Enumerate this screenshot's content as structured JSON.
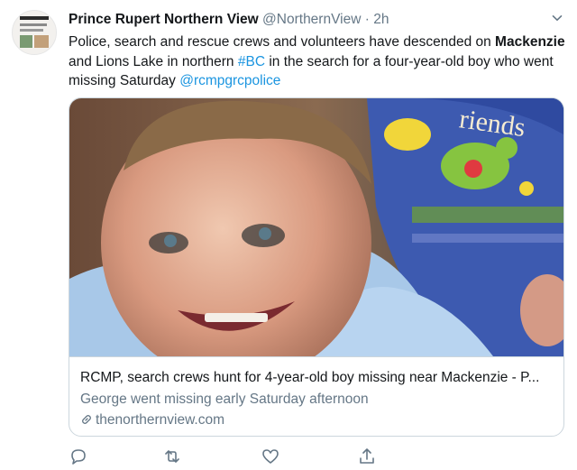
{
  "tweet": {
    "author_name": "Prince Rupert Northern View",
    "handle": "@NorthernView",
    "separator": "·",
    "time": "2h",
    "text": {
      "part1": "Police, search and rescue crews and volunteers have descended on ",
      "bold": "Mackenzie",
      "part2": " and Lions Lake in northern ",
      "hashtag": "#BC",
      "part3": " in the search for a four-year-old boy who went missing Saturday ",
      "mention": "@rcmpgrcpolice"
    },
    "card": {
      "title": "RCMP, search crews hunt for 4-year-old boy missing near Mackenzie - P...",
      "description": "George went missing early Saturday afternoon",
      "domain": "thenorthernview.com",
      "photo_words": "riends"
    },
    "actions": [
      "reply-icon",
      "retweet-icon",
      "like-icon",
      "share-icon"
    ]
  },
  "colors": {
    "link": "#1b95e0",
    "secondary_text": "#657786",
    "border": "#ccd6dd",
    "icon": "#657786"
  }
}
